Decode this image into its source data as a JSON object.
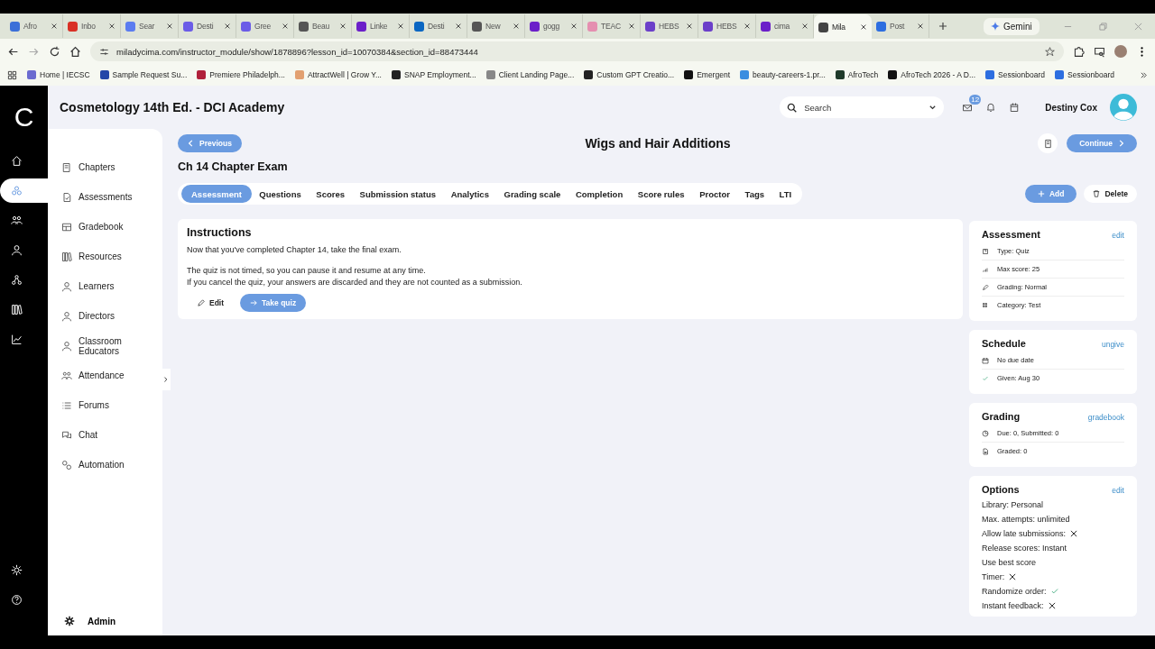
{
  "browser": {
    "tabs": [
      {
        "label": "Afro",
        "color": "#3b6fd8",
        "selected": false
      },
      {
        "label": "Inbo",
        "color": "#d93025",
        "selected": false
      },
      {
        "label": "Sear",
        "color": "#5b7cf0",
        "selected": false
      },
      {
        "label": "Desti",
        "color": "#6b5ce7",
        "selected": false
      },
      {
        "label": "Gree",
        "color": "#6b5ce7",
        "selected": false
      },
      {
        "label": "Beau",
        "color": "#555555",
        "selected": false
      },
      {
        "label": "Linke",
        "color": "#6b1fc9",
        "selected": false
      },
      {
        "label": "Desti",
        "color": "#0a66c2",
        "selected": false
      },
      {
        "label": "New",
        "color": "#555555",
        "selected": false
      },
      {
        "label": "gogg",
        "color": "#6b1fc9",
        "selected": false
      },
      {
        "label": "TEAC",
        "color": "#e58fb0",
        "selected": false
      },
      {
        "label": "HEBS",
        "color": "#6b3fc9",
        "selected": false
      },
      {
        "label": "HEBS",
        "color": "#6b3fc9",
        "selected": false
      },
      {
        "label": "cima",
        "color": "#6b1fc9",
        "selected": false
      },
      {
        "label": "Mila",
        "color": "#444444",
        "selected": true
      },
      {
        "label": "Post",
        "color": "#2d6ee0",
        "selected": false
      }
    ],
    "gemini": "Gemini",
    "url": "miladycima.com/instructor_module/show/1878896?lesson_id=10070384&section_id=88473444",
    "bookmarks": [
      {
        "label": "Home | IECSC",
        "color": "#6b6bd0"
      },
      {
        "label": "Sample Request Su...",
        "color": "#2347a8"
      },
      {
        "label": "Premiere Philadelph...",
        "color": "#b0203a"
      },
      {
        "label": "AttractWell | Grow Y...",
        "color": "#e2a070"
      },
      {
        "label": "SNAP Employment...",
        "color": "#222222"
      },
      {
        "label": "Client Landing Page...",
        "color": "#888888"
      },
      {
        "label": "Custom GPT Creatio...",
        "color": "#222222"
      },
      {
        "label": "Emergent",
        "color": "#111111"
      },
      {
        "label": "beauty-careers-1.pr...",
        "color": "#3a8ee0"
      },
      {
        "label": "AfroTech",
        "color": "#1f3a2a"
      },
      {
        "label": "AfroTech 2026 - A D...",
        "color": "#111111"
      },
      {
        "label": "Sessionboard",
        "color": "#2d6ee0"
      },
      {
        "label": "Sessionboard",
        "color": "#2d6ee0"
      }
    ]
  },
  "app": {
    "logo": "C",
    "rail": [
      {
        "kind": "home",
        "selected": false
      },
      {
        "kind": "cluster",
        "selected": true
      },
      {
        "kind": "people",
        "selected": false
      },
      {
        "kind": "person",
        "selected": false
      },
      {
        "kind": "network",
        "selected": false
      },
      {
        "kind": "books",
        "selected": false
      },
      {
        "kind": "chart",
        "selected": false
      }
    ],
    "header": {
      "title": "Cosmetology 14th Ed. - DCI Academy",
      "search": {
        "placeholder": "Search"
      },
      "mail_badge": "12",
      "user": "Destiny Cox"
    },
    "sidebar": {
      "items": [
        {
          "label": "Chapters",
          "kind": "book"
        },
        {
          "label": "Assessments",
          "kind": "doc"
        },
        {
          "label": "Gradebook",
          "kind": "table"
        },
        {
          "label": "Resources",
          "kind": "books"
        },
        {
          "label": "Learners",
          "kind": "person"
        },
        {
          "label": "Directors",
          "kind": "person"
        },
        {
          "label": "Classroom Educators",
          "kind": "person"
        },
        {
          "label": "Attendance",
          "kind": "people"
        },
        {
          "label": "Forums",
          "kind": "list"
        },
        {
          "label": "Chat",
          "kind": "chat"
        },
        {
          "label": "Automation",
          "kind": "gears"
        }
      ],
      "footer": "Admin"
    },
    "lesson": {
      "previous": "Previous",
      "title": "Wigs and Hair Additions",
      "continue": "Continue",
      "exam_title": "Ch 14 Chapter Exam"
    },
    "tabs": [
      {
        "label": "Assessment",
        "selected": true
      },
      {
        "label": "Questions",
        "selected": false
      },
      {
        "label": "Scores",
        "selected": false
      },
      {
        "label": "Submission status",
        "selected": false
      },
      {
        "label": "Analytics",
        "selected": false
      },
      {
        "label": "Grading scale",
        "selected": false
      },
      {
        "label": "Completion",
        "selected": false
      },
      {
        "label": "Score rules",
        "selected": false
      },
      {
        "label": "Proctor",
        "selected": false
      },
      {
        "label": "Tags",
        "selected": false
      },
      {
        "label": "LTI",
        "selected": false
      }
    ],
    "actions": {
      "add": "Add",
      "delete": "Delete"
    },
    "instructions": {
      "heading": "Instructions",
      "paragraphs": [
        [
          "Now that you've completed Chapter 14, take the final exam."
        ],
        [
          "The quiz is not timed, so you can pause it and resume at any time.",
          "If you cancel the quiz, your answers are discarded and they are not counted as a submission."
        ]
      ],
      "edit": "Edit",
      "take_quiz": "Take quiz"
    },
    "cards": [
      {
        "title": "Assessment",
        "link": "edit",
        "rows": [
          {
            "label": "Type: Quiz",
            "kind": "qbox"
          },
          {
            "label": "Max score: 25",
            "kind": "bars"
          },
          {
            "label": "Grading: Normal",
            "kind": "pen"
          },
          {
            "label": "Category: Test",
            "kind": "grid"
          }
        ]
      },
      {
        "title": "Schedule",
        "link": "ungive",
        "rows": [
          {
            "label": "No due date",
            "kind": "calendar"
          },
          {
            "label": "Given: Aug 30",
            "kind": "check"
          }
        ]
      },
      {
        "title": "Grading",
        "link": "gradebook",
        "rows": [
          {
            "label": "Due: 0, Submitted: 0",
            "kind": "pie"
          },
          {
            "label": "Graded: 0",
            "kind": "docs"
          }
        ]
      }
    ],
    "options": {
      "title": "Options",
      "link": "edit",
      "items": [
        {
          "label": "Library: Personal",
          "kind": "text"
        },
        {
          "label": "Max. attempts: unlimited",
          "kind": "text"
        },
        {
          "label": "Allow late submissions:",
          "kind": "flag",
          "on": false
        },
        {
          "label": "Release scores: Instant",
          "kind": "text"
        },
        {
          "label": "Use best score",
          "kind": "text"
        },
        {
          "label": "Timer:",
          "kind": "flag",
          "on": false
        },
        {
          "label": "Randomize order:",
          "kind": "flag",
          "on": true
        },
        {
          "label": "Instant feedback:",
          "kind": "flag",
          "on": false
        }
      ]
    }
  }
}
